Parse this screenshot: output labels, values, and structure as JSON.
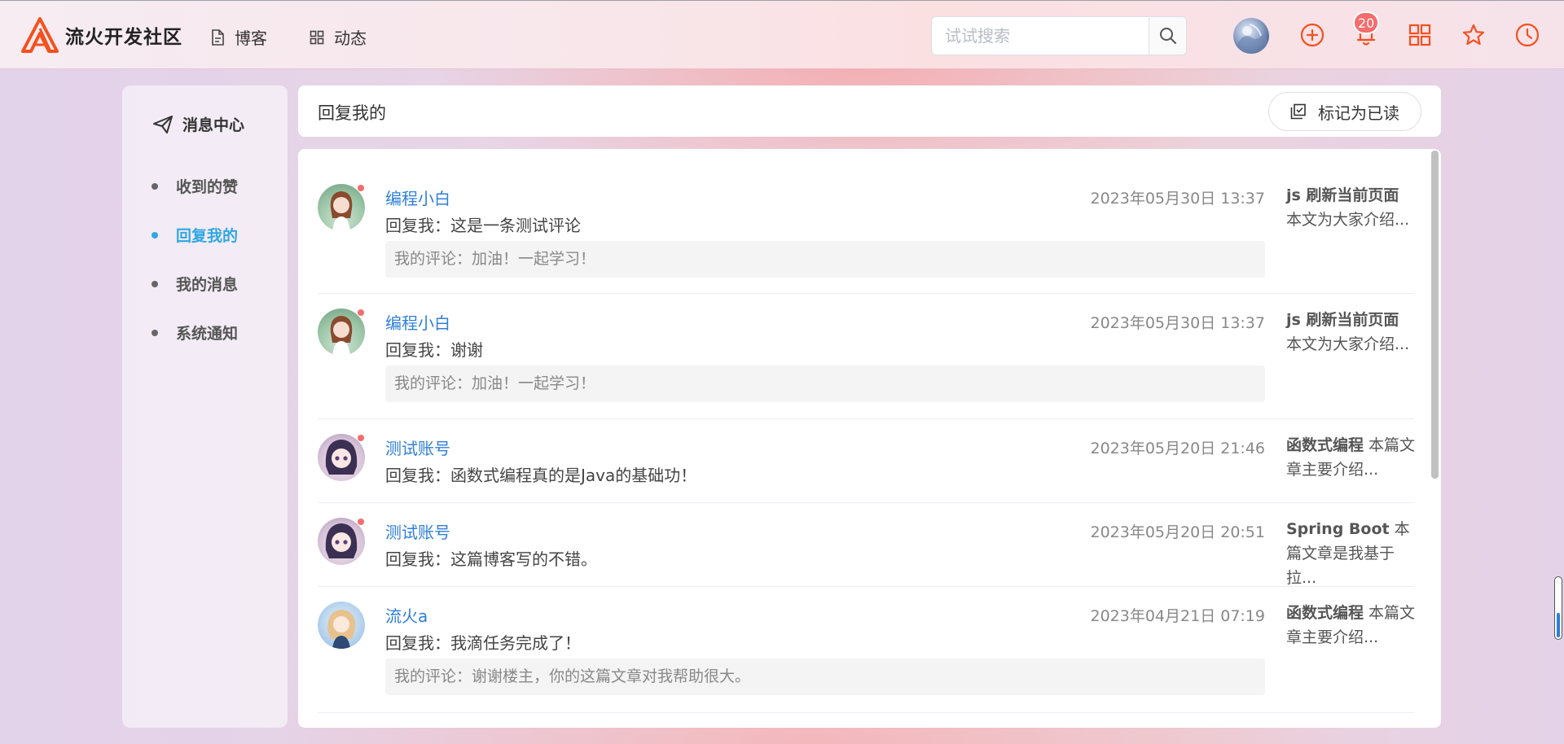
{
  "header": {
    "brand": "流火开发社区",
    "nav": [
      {
        "label": "博客",
        "icon": "document-icon"
      },
      {
        "label": "动态",
        "icon": "grid-icon"
      }
    ],
    "search": {
      "placeholder": "试试搜索",
      "value": ""
    },
    "notifications_count": "20",
    "icons": [
      "plus-circle-icon",
      "bell-icon",
      "grid-icon",
      "star-icon",
      "clock-icon"
    ]
  },
  "sidebar": {
    "title": "消息中心",
    "items": [
      {
        "label": "收到的赞",
        "active": false
      },
      {
        "label": "回复我的",
        "active": true
      },
      {
        "label": "我的消息",
        "active": false
      },
      {
        "label": "系统通知",
        "active": false
      }
    ]
  },
  "topbar": {
    "title": "回复我的",
    "mark_read_label": "标记为已读"
  },
  "messages": [
    {
      "user": "编程小白",
      "time": "2023年05月30日 13:37",
      "reply": "回复我：这是一条测试评论",
      "my_comment": "我的评论：加油！一起学习！",
      "article_title": "js 刷新当前页面",
      "article_summary": "本文为大家介绍...",
      "unread": true
    },
    {
      "user": "编程小白",
      "time": "2023年05月30日 13:37",
      "reply": "回复我：谢谢",
      "my_comment": "我的评论：加油！一起学习！",
      "article_title": "js 刷新当前页面",
      "article_summary": "本文为大家介绍...",
      "unread": true
    },
    {
      "user": "测试账号",
      "time": "2023年05月20日 21:46",
      "reply": "回复我：函数式编程真的是Java的基础功！",
      "my_comment": "",
      "article_title": "函数式编程",
      "article_summary": " 本篇文章主要介绍...",
      "unread": true
    },
    {
      "user": "测试账号",
      "time": "2023年05月20日 20:51",
      "reply": "回复我：这篇博客写的不错。",
      "my_comment": "",
      "article_title": "Spring Boot",
      "article_summary": " 本篇文章是我基于拉...",
      "unread": true
    },
    {
      "user": "流火a",
      "time": "2023年04月21日 07:19",
      "reply": "回复我：我滴任务完成了！",
      "my_comment": "我的评论：谢谢楼主，你的这篇文章对我帮助很大。",
      "article_title": "函数式编程",
      "article_summary": " 本篇文章主要介绍...",
      "unread": false
    }
  ],
  "colors": {
    "accent_blue": "#2f7fd8",
    "active_menu": "#2fa7e4",
    "brand_orange": "#f4511e",
    "unread_red": "#f56c6c"
  }
}
